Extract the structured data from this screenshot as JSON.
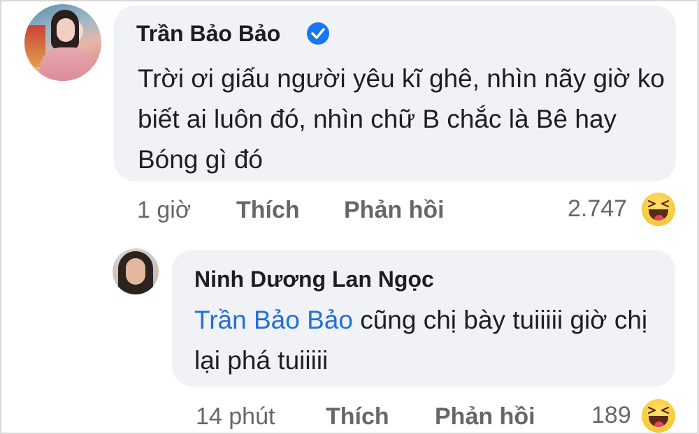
{
  "comments": [
    {
      "author": "Trần Bảo Bảo",
      "verified": true,
      "text": "Trời ơi giấu người yêu kĩ ghê, nhìn nãy giờ ko biết ai luôn đó, nhìn chữ B chắc là Bê hay Bóng gì đó",
      "time": "1 giờ",
      "like_label": "Thích",
      "reply_label": "Phản hồi",
      "reaction_count": "2.747",
      "reaction_icon": "haha-emoji-icon"
    },
    {
      "author": "Ninh Dương Lan Ngọc",
      "mention": "Trần Bảo Bảo",
      "text_after_mention": " cũng chị bày tuiiiii giờ chị lại phá tuiiiii",
      "time": "14 phút",
      "like_label": "Thích",
      "reply_label": "Phản hồi",
      "reaction_count": "189",
      "reaction_icon": "haha-emoji-icon"
    }
  ],
  "colors": {
    "bubble": "#f0f2f5",
    "meta_text": "#65676b",
    "mention": "#216fdb",
    "verified": "#1877f2"
  }
}
